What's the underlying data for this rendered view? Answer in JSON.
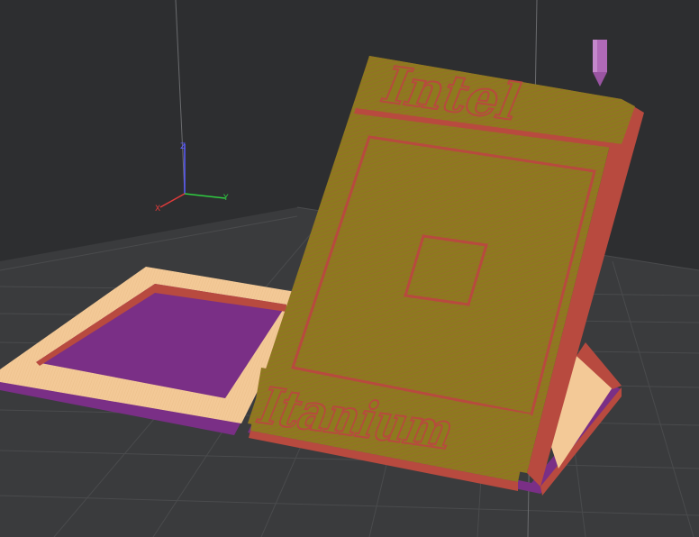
{
  "viewport": {
    "background_color": "#2d2e30",
    "bed_color": "#3a3b3d",
    "bed_grid_color": "#4a4b4d"
  },
  "axes": {
    "x_label": "X",
    "y_label": "Y",
    "z_label": "Z",
    "x_color": "#e23b3b",
    "y_color": "#2ecc40",
    "z_color": "#5b5bff"
  },
  "model": {
    "upper_text": "Intel",
    "lower_text": "Itanium",
    "infill_color": "#8d7a1e",
    "wall_color": "#b84a3f",
    "skirt_color": "#f3c997",
    "support_color": "#7a2f86"
  },
  "nozzle": {
    "color": "#b06ab8",
    "icon": "nozzle-icon"
  }
}
